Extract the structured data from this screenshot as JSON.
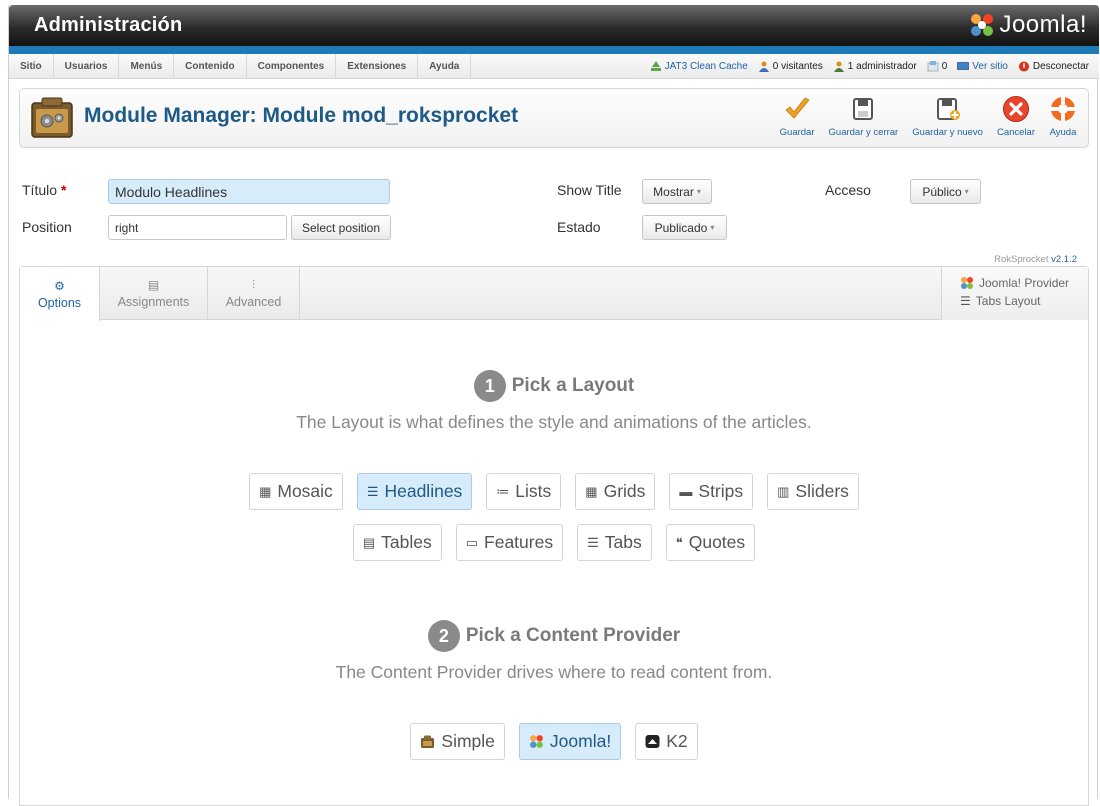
{
  "header": {
    "title": "Administración",
    "brand": "Joomla!"
  },
  "menu": {
    "items": [
      {
        "label": "Sitio"
      },
      {
        "label": "Usuarios"
      },
      {
        "label": "Menús"
      },
      {
        "label": "Contenido"
      },
      {
        "label": "Componentes"
      },
      {
        "label": "Extensiones"
      },
      {
        "label": "Ayuda"
      }
    ],
    "status": {
      "cache": "JAT3 Clean Cache",
      "visitors": "0 visitantes",
      "admins": "1 administrador",
      "messages": "0",
      "view_site": "Ver sitio",
      "logout": "Desconectar"
    }
  },
  "toolbar": {
    "page_title": "Module Manager: Module mod_roksprocket",
    "buttons": [
      {
        "label": "Guardar",
        "icon": "check-icon"
      },
      {
        "label": "Guardar y cerrar",
        "icon": "save-close-icon"
      },
      {
        "label": "Guardar y nuevo",
        "icon": "save-new-icon"
      },
      {
        "label": "Cancelar",
        "icon": "cancel-icon"
      },
      {
        "label": "Ayuda",
        "icon": "help-icon"
      }
    ]
  },
  "form": {
    "title_label": "Título",
    "title_required": "*",
    "title_value": "Modulo Headlines",
    "position_label": "Position",
    "position_value": "right",
    "select_position": "Select position",
    "show_title_label": "Show Title",
    "show_title_value": "Mostrar",
    "estado_label": "Estado",
    "estado_value": "Publicado",
    "acceso_label": "Acceso",
    "acceso_value": "Público"
  },
  "version": {
    "prefix": "RokSprocket",
    "number": "v2.1.2"
  },
  "tabs": [
    {
      "label": "Options",
      "icon": "gear-icon",
      "active": true
    },
    {
      "label": "Assignments",
      "icon": "assignments-icon",
      "active": false
    },
    {
      "label": "Advanced",
      "icon": "sliders-icon",
      "active": false
    }
  ],
  "provider_box": {
    "provider": "Joomla! Provider",
    "layout": "Tabs Layout"
  },
  "layout_section": {
    "number": "1",
    "title": "Pick a Layout",
    "description": "The Layout is what defines the style and animations of the articles.",
    "row1": [
      {
        "label": "Mosaic",
        "icon": "mosaic-icon",
        "selected": false
      },
      {
        "label": "Headlines",
        "icon": "headlines-icon",
        "selected": true
      },
      {
        "label": "Lists",
        "icon": "lists-icon",
        "selected": false
      },
      {
        "label": "Grids",
        "icon": "grids-icon",
        "selected": false
      },
      {
        "label": "Strips",
        "icon": "strips-icon",
        "selected": false
      },
      {
        "label": "Sliders",
        "icon": "sliders-layout-icon",
        "selected": false
      }
    ],
    "row2": [
      {
        "label": "Tables",
        "icon": "tables-icon",
        "selected": false
      },
      {
        "label": "Features",
        "icon": "features-icon",
        "selected": false
      },
      {
        "label": "Tabs",
        "icon": "tabs-icon",
        "selected": false
      },
      {
        "label": "Quotes",
        "icon": "quotes-icon",
        "selected": false
      }
    ]
  },
  "provider_section": {
    "number": "2",
    "title": "Pick a Content Provider",
    "description": "The Content Provider drives where to read content from.",
    "options": [
      {
        "label": "Simple",
        "icon": "simple-provider-icon",
        "selected": false
      },
      {
        "label": "Joomla!",
        "icon": "joomla-icon",
        "selected": true
      },
      {
        "label": "K2",
        "icon": "k2-icon",
        "selected": false
      }
    ]
  },
  "colors": {
    "accent_blue": "#1f7ab8",
    "title_blue": "#1d5a86",
    "selected_bg": "#d7ecfb"
  }
}
